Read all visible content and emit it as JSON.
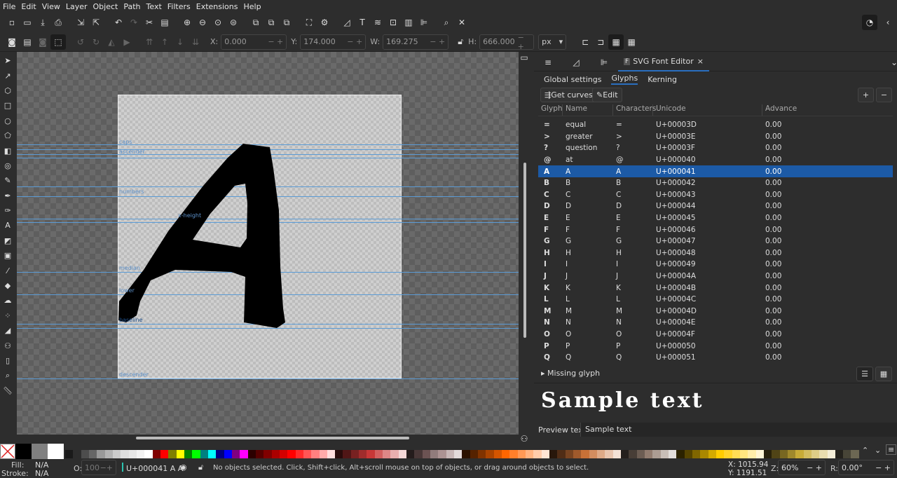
{
  "menu": [
    "File",
    "Edit",
    "View",
    "Layer",
    "Object",
    "Path",
    "Text",
    "Filters",
    "Extensions",
    "Help"
  ],
  "controls": {
    "x_label": "X:",
    "x": "0.000",
    "y_label": "Y:",
    "y": "174.000",
    "w_label": "W:",
    "w": "169.275",
    "h_label": "H:",
    "h": "666.000",
    "unit": "px"
  },
  "guides": [
    "caps",
    "ascender",
    "numbers",
    "x-height",
    "median",
    "lower",
    "baseline",
    "descender"
  ],
  "panel": {
    "tab_label": "SVG Font Editor",
    "subtabs": [
      "Global settings",
      "Glyphs",
      "Kerning"
    ],
    "get_curves": "Get curves",
    "edit": "Edit",
    "add": "+",
    "remove": "−",
    "columns": [
      "Glyph",
      "Name",
      "Characters",
      "Unicode",
      "Advance"
    ],
    "glyphs": [
      [
        "=",
        "equal",
        "=",
        "U+00003D",
        "0.00"
      ],
      [
        ">",
        "greater",
        ">",
        "U+00003E",
        "0.00"
      ],
      [
        "?",
        "question",
        "?",
        "U+00003F",
        "0.00"
      ],
      [
        "@",
        "at",
        "@",
        "U+000040",
        "0.00"
      ],
      [
        "A",
        "A",
        "A",
        "U+000041",
        "0.00"
      ],
      [
        "B",
        "B",
        "B",
        "U+000042",
        "0.00"
      ],
      [
        "C",
        "C",
        "C",
        "U+000043",
        "0.00"
      ],
      [
        "D",
        "D",
        "D",
        "U+000044",
        "0.00"
      ],
      [
        "E",
        "E",
        "E",
        "U+000045",
        "0.00"
      ],
      [
        "F",
        "F",
        "F",
        "U+000046",
        "0.00"
      ],
      [
        "G",
        "G",
        "G",
        "U+000047",
        "0.00"
      ],
      [
        "H",
        "H",
        "H",
        "U+000048",
        "0.00"
      ],
      [
        "I",
        "I",
        "I",
        "U+000049",
        "0.00"
      ],
      [
        "J",
        "J",
        "J",
        "U+00004A",
        "0.00"
      ],
      [
        "K",
        "K",
        "K",
        "U+00004B",
        "0.00"
      ],
      [
        "L",
        "L",
        "L",
        "U+00004C",
        "0.00"
      ],
      [
        "M",
        "M",
        "M",
        "U+00004D",
        "0.00"
      ],
      [
        "N",
        "N",
        "N",
        "U+00004E",
        "0.00"
      ],
      [
        "O",
        "O",
        "O",
        "U+00004F",
        "0.00"
      ],
      [
        "P",
        "P",
        "P",
        "U+000050",
        "0.00"
      ],
      [
        "Q",
        "Q",
        "Q",
        "U+000051",
        "0.00"
      ]
    ],
    "selected_index": 4,
    "missing_glyph": "Missing glyph",
    "preview_sample": "Sample text",
    "preview_label": "Preview text:",
    "preview_value": "Sample text"
  },
  "status": {
    "fill_label": "Fill:",
    "fill": "N/A",
    "stroke_label": "Stroke:",
    "stroke": "N/A",
    "opacity_label": "O:",
    "opacity": "100",
    "layer": "U+000041 A A",
    "message": "No objects selected. Click, Shift+click, Alt+scroll mouse on top of objects, or drag around objects to select.",
    "cx": "X: 1015.94",
    "cy": "Y: 1191.51",
    "zoom_label": "Z:",
    "zoom": "60%",
    "rot_label": "R:",
    "rotation": "0.00°"
  },
  "palette": [
    "#1a1a1a",
    "#2d2d2d",
    "#4d4d4d",
    "#666",
    "#999",
    "#b3b3b3",
    "#ccc",
    "#ddd",
    "#e6e6e6",
    "#f2f2f2",
    "#fff",
    "#800000",
    "#f00",
    "#808000",
    "#ff0",
    "#008000",
    "#0f0",
    "#008080",
    "#0ff",
    "#000080",
    "#00f",
    "#800080",
    "#f0f",
    "#2b0000",
    "#550000",
    "#800000",
    "#aa0000",
    "#d40000",
    "#f00",
    "#ff2a2a",
    "#f55",
    "#ff8080",
    "#faa",
    "#fdd",
    "#280b0b",
    "#501616",
    "#782121",
    "#a02c2c",
    "#c83737",
    "#d35f5f",
    "#de8787",
    "#e9afaf",
    "#f4d7d7",
    "#241c1c",
    "#483737",
    "#6c5353",
    "#917c7c",
    "#ac9393",
    "#c8b7b7",
    "#e3dbdb",
    "#2b1100",
    "#552200",
    "#803300",
    "#a40",
    "#d45500",
    "#f60",
    "#ff7f2a",
    "#f95",
    "#ffb380",
    "#fca",
    "#ffe6d5",
    "#28170b",
    "#502d16",
    "#784421",
    "#a05a2c",
    "#c87137",
    "#d38d5f",
    "#deaa87",
    "#e9c6af",
    "#f4e3d7",
    "#241f1c",
    "#483e37",
    "#6c5d53",
    "#917c6f",
    "#ac9d93",
    "#c8beb7",
    "#e3dedb",
    "#2b2200",
    "#554400",
    "#806600",
    "#a80",
    "#d4aa00",
    "#fc0",
    "#ffd42a",
    "#fd5",
    "#ffe680",
    "#fea",
    "#fff6d5",
    "#28220b",
    "#504416",
    "#786721",
    "#a0892c",
    "#c8ab37",
    "#d3bc5f",
    "#decd87",
    "#e9ddaf",
    "#f4eed7",
    "#24221c",
    "#484537",
    "#6c6753"
  ]
}
